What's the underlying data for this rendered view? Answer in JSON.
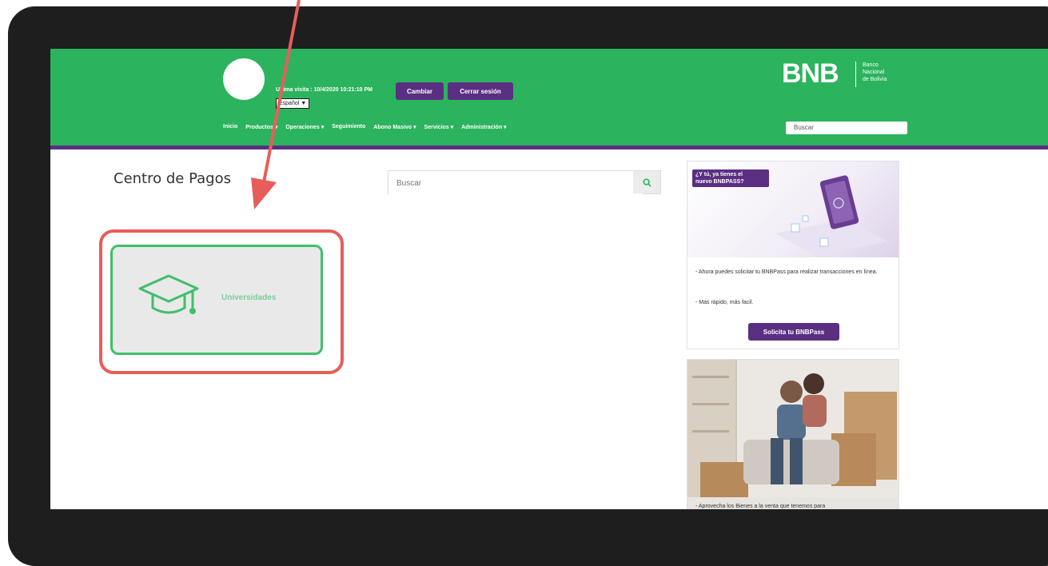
{
  "header": {
    "last_visit": "Ultima visita : 10/4/2020 10:21:10 PM",
    "language": "Español",
    "change_button": "Cambiar",
    "logout_button": "Cerrar sesión",
    "search_placeholder": "Buscar",
    "nav": [
      {
        "label": "Inicio"
      },
      {
        "label": "Productos ▾"
      },
      {
        "label": "Operaciones ▾"
      },
      {
        "label": "Seguimiento"
      },
      {
        "label": "Abono Masivo ▾"
      },
      {
        "label": "Servicios ▾"
      },
      {
        "label": "Administración ▾"
      }
    ]
  },
  "logo": {
    "name": "BNB",
    "subtitle_1": "Banco",
    "subtitle_2": "Nacional",
    "subtitle_3": "de Bolivia"
  },
  "main": {
    "title": "Centro de Pagos",
    "search_placeholder": "Buscar",
    "card_label": "Universidades"
  },
  "promo": {
    "tag_line1": "¿Y tú, ya tienes el",
    "tag_line2": "nuevo BNBPASS?",
    "text1": "- Ahora puedes solicitar tu BNBPass para realizar transacciones en línea.",
    "text2": "- Mas rápido, más facil.",
    "button": "Solicita tu BNBPass"
  },
  "photo_caption": "- Aprovecha los Bienes a la venta que tenemos para",
  "colors": {
    "header_green": "#2cb35d",
    "brand_purple": "#5a2f82",
    "highlight_red": "#e85d5a",
    "card_border_green": "#3fbf6b"
  }
}
